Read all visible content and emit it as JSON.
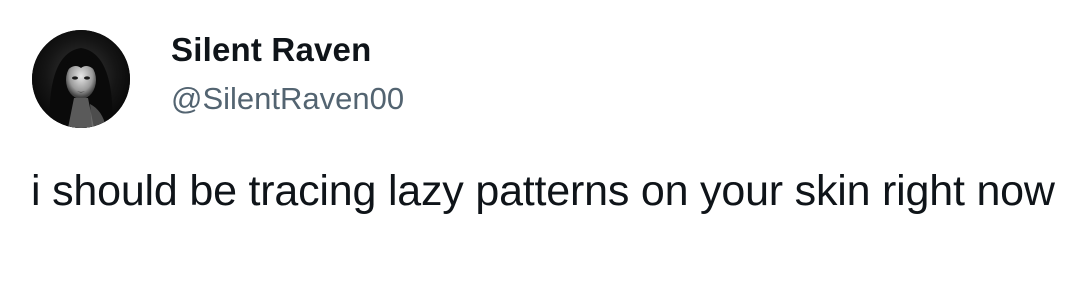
{
  "author": {
    "display_name": "Silent Raven",
    "handle": "@SilentRaven00",
    "avatar_icon": "avatar-dark-portrait"
  },
  "tweet": {
    "text": "i should be tracing lazy patterns on your skin right now"
  },
  "colors": {
    "background": "#ffffff",
    "text_primary": "#0f1419",
    "text_secondary": "#536471"
  }
}
